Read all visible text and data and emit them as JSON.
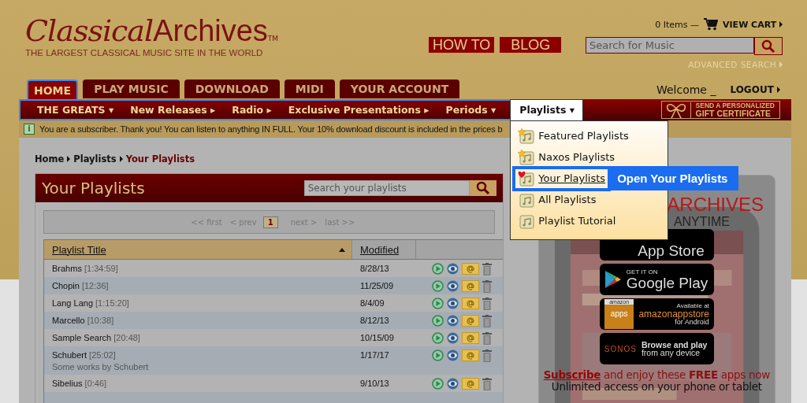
{
  "logo": {
    "script": "Classical",
    "word": "Archives",
    "trademark": "TM",
    "tagline": "THE LARGEST CLASSICAL MUSIC SITE IN THE WORLD"
  },
  "header_links": [
    "HOW TO",
    "BLOG"
  ],
  "cart": {
    "items": "0 Items —",
    "label": "VIEW CART"
  },
  "search": {
    "placeholder": "Search for Music"
  },
  "advanced_search": "ADVANCED SEARCH",
  "tabs": [
    {
      "label": "HOME",
      "selected": true
    },
    {
      "label": "PLAY MUSIC",
      "selected": false
    },
    {
      "label": "DOWNLOAD",
      "selected": false
    },
    {
      "label": "MIDI",
      "selected": false
    },
    {
      "label": "YOUR ACCOUNT",
      "selected": false
    }
  ],
  "welcome": "Welcome _",
  "logout": "LOGOUT",
  "nav": [
    {
      "label": "THE GREATS",
      "arrow": "▾",
      "selected": false
    },
    {
      "label": "New Releases",
      "arrow": "▸",
      "selected": false
    },
    {
      "label": "Radio",
      "arrow": "▸",
      "selected": false
    },
    {
      "label": "Exclusive Presentations",
      "arrow": "▸",
      "selected": false
    },
    {
      "label": "Periods",
      "arrow": "▾",
      "selected": false
    },
    {
      "label": "Playlists",
      "arrow": "▾",
      "selected": true
    }
  ],
  "gift": {
    "line1": "SEND A PERSONALIZED",
    "line2": "GIFT CERTIFICATE"
  },
  "notice": {
    "icon": "i",
    "text": "You are a subscriber. Thank you! You can listen to anything IN FULL. Your 10% download discount is included in the prices b"
  },
  "breadcrumb": [
    {
      "label": "Home",
      "current": false
    },
    {
      "label": "Playlists",
      "current": false
    },
    {
      "label": "Your Playlists",
      "current": true
    }
  ],
  "panel": {
    "title": "Your Playlists",
    "search_placeholder": "Search your playlists"
  },
  "pager": {
    "first": "<< first",
    "prev": "< prev",
    "page": "1",
    "next": "next >",
    "last": "last >>"
  },
  "table": {
    "columns": [
      {
        "label": "Playlist Title",
        "sorted": true
      },
      {
        "label": "Modified",
        "sorted": false
      }
    ],
    "rows": [
      {
        "title": "Brahms",
        "duration": "[1:34:59]",
        "modified": "8/28/13"
      },
      {
        "title": "Chopin",
        "duration": "[12:36]",
        "modified": "11/25/09"
      },
      {
        "title": "Lang Lang",
        "duration": "[1:15:20]",
        "modified": "8/4/09"
      },
      {
        "title": "Marcello",
        "duration": "[10:38]",
        "modified": "8/12/13"
      },
      {
        "title": "Sample Search",
        "duration": "[20:48]",
        "modified": "10/15/09"
      },
      {
        "title": "Schubert",
        "duration": "[25:02]",
        "note": "Some works by Schubert",
        "modified": "1/17/17"
      },
      {
        "title": "Sibelius",
        "duration": "[0:46]",
        "modified": "9/10/13"
      }
    ]
  },
  "dropdown": [
    {
      "label": "Featured Playlists",
      "kind": "star",
      "selected": false
    },
    {
      "label": "Naxos Playlists",
      "kind": "star",
      "selected": false
    },
    {
      "label": "Your Playlists",
      "kind": "heart",
      "selected": true
    },
    {
      "label": "All Playlists",
      "kind": "plain",
      "selected": false
    },
    {
      "label": "Playlist Tutorial",
      "kind": "plain",
      "selected": false
    }
  ],
  "tooltip": "Open Your Playlists",
  "promo": {
    "title": "ARCHIVES",
    "subtitle": "ANYTIME",
    "badges": [
      {
        "kind": "apple",
        "big": "App Store"
      },
      {
        "kind": "google",
        "small": "GET IT ON",
        "big": "Google Play"
      },
      {
        "kind": "amazon",
        "small": "Available at",
        "big": "amazonappstore",
        "sub": "for Android",
        "tile_top": "amazon",
        "tile_bottom": "apps"
      },
      {
        "kind": "sonos",
        "brand": "SONOS",
        "small": "Browse and play",
        "big": "from any device"
      }
    ],
    "subscribe": "Subscribe",
    "offer": "and enjoy these **FREE** apps now",
    "access": "Unlimited access on your phone or tablet"
  }
}
